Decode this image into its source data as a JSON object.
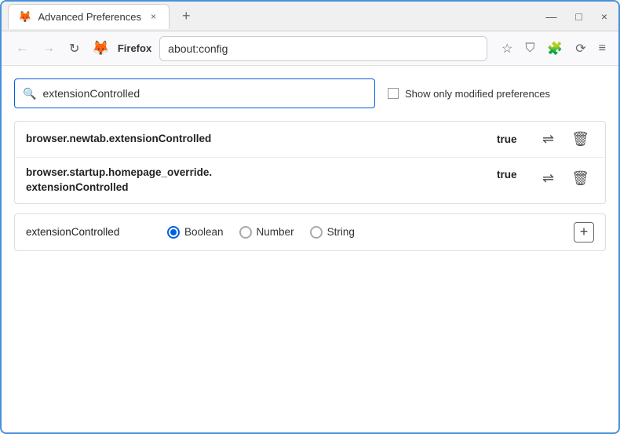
{
  "window": {
    "title": "Advanced Preferences",
    "tab_close": "×",
    "tab_add": "+",
    "win_minimize": "—",
    "win_maximize": "□",
    "win_close": "×"
  },
  "nav": {
    "back": "←",
    "forward": "→",
    "reload": "↻",
    "browser_name": "Firefox",
    "url": "about:config",
    "star_icon": "☆",
    "shield_icon": "⛉",
    "extension_icon": "🧩",
    "menu_icon": "≡"
  },
  "search": {
    "placeholder": "",
    "value": "extensionControlled",
    "show_modified_label": "Show only modified preferences"
  },
  "results": [
    {
      "name": "browser.newtab.extensionControlled",
      "value": "true"
    },
    {
      "name": "browser.startup.homepage_override.\nextensionControlled",
      "name_line1": "browser.startup.homepage_override.",
      "name_line2": "extensionControlled",
      "value": "true",
      "multiline": true
    }
  ],
  "new_pref": {
    "name": "extensionControlled",
    "types": [
      {
        "id": "boolean",
        "label": "Boolean",
        "selected": true
      },
      {
        "id": "number",
        "label": "Number",
        "selected": false
      },
      {
        "id": "string",
        "label": "String",
        "selected": false
      }
    ],
    "add_label": "+"
  },
  "icons": {
    "swap": "⇌",
    "delete": "🗑"
  }
}
